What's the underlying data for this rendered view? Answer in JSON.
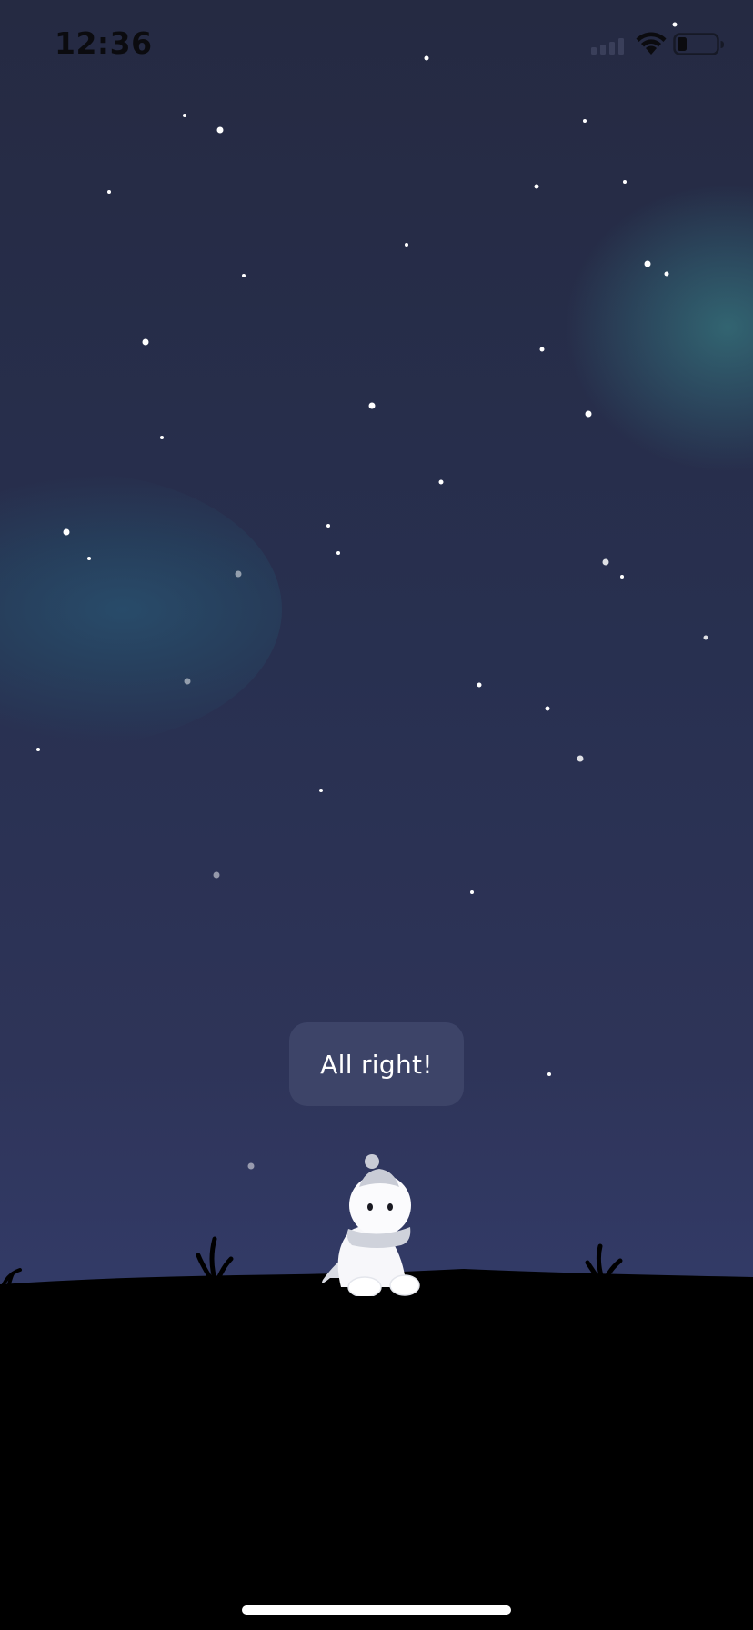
{
  "status_bar": {
    "time": "12:36",
    "signal_icon": "cellular-signal-icon",
    "wifi_icon": "wifi-icon",
    "battery_icon": "battery-low-icon",
    "battery_level": 0.2
  },
  "scene": {
    "sky_colors": [
      "#252a42",
      "#323a66"
    ],
    "nebula_color": "#346e78",
    "ground_color": "#000000",
    "character": "snow-spirit-with-beanie-and-scarf"
  },
  "dialogue": {
    "text": "All right!"
  },
  "colors": {
    "bubble": "#3d4468",
    "text": "#ffffff",
    "star": "#ffffff"
  }
}
